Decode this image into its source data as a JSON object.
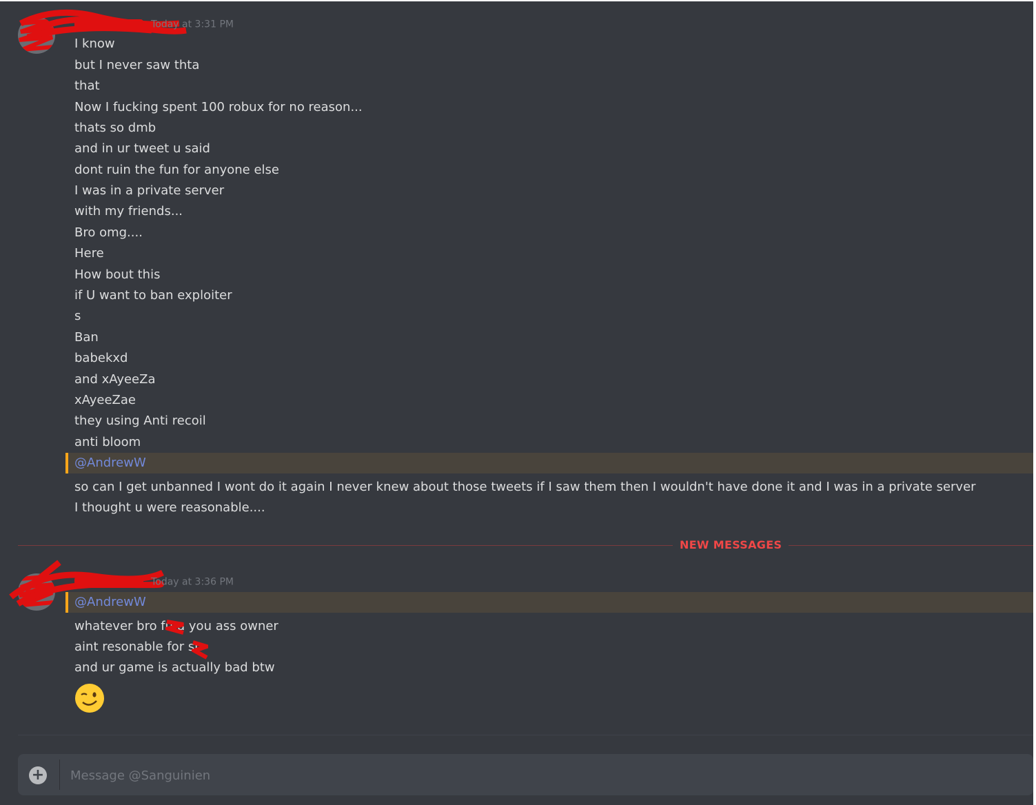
{
  "groups": [
    {
      "timestamp": "Today at 3:31 PM",
      "messages": [
        "I know",
        "but I never saw thta",
        "that",
        "Now I fucking spent 100 robux for no reason...",
        "thats so dmb",
        "and in ur tweet u said",
        "dont ruin the fun for anyone else",
        "I was in a private server",
        "with my friends...",
        "Bro omg....",
        "Here",
        "How bout this",
        "if U want to ban exploiter",
        "s",
        "Ban",
        "babekxd",
        "and xAyeeZa",
        "xAyeeZae",
        "they using Anti recoil",
        "anti bloom"
      ],
      "mention": "@AndrewW",
      "after_mention": [
        "so can I get unbanned I wont do it again I never knew about those tweets if I saw them then I wouldn't have done it and I was in a private server",
        "I thought u were reasonable...."
      ]
    },
    {
      "timestamp": "Today at 3:36 PM",
      "mention": "@AndrewW",
      "messages": [
        "whatever bro fu   u  you ass owner",
        "aint resonable for sh",
        "and ur game is actually bad btw"
      ],
      "emoji": "winking-face"
    }
  ],
  "divider": {
    "label": "NEW MESSAGES"
  },
  "composer": {
    "placeholder": "Message @Sanguinien"
  },
  "colors": {
    "background": "#36393f",
    "mention_text": "#7289da",
    "mention_bg": "#49443c",
    "mention_bar": "#faa61a",
    "new_messages": "#f04747",
    "redaction": "#e01010"
  }
}
